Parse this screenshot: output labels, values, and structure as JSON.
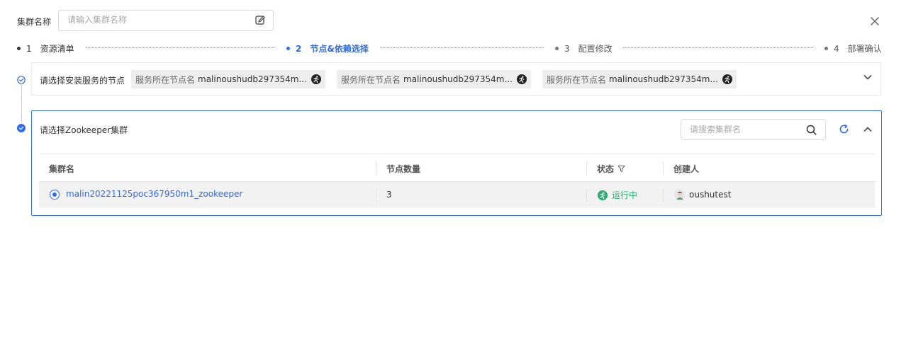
{
  "header": {
    "cluster_name_label": "集群名称",
    "cluster_name_placeholder": "请输入集群名称"
  },
  "steps": [
    {
      "num": "1",
      "label": "资源清单",
      "state": "done"
    },
    {
      "num": "2",
      "label": "节点&依赖选择",
      "state": "active"
    },
    {
      "num": "3",
      "label": "配置修改",
      "state": "todo"
    },
    {
      "num": "4",
      "label": "部署确认",
      "state": "todo"
    }
  ],
  "node_section": {
    "title": "请选择安装服务的节点",
    "tags": [
      {
        "key": "服务所在节点名",
        "value": "malinoushudb297354m..."
      },
      {
        "key": "服务所在节点名",
        "value": "malinoushudb297354m..."
      },
      {
        "key": "服务所在节点名",
        "value": "malinoushudb297354m..."
      }
    ]
  },
  "zk_section": {
    "title": "请选择Zookeeper集群",
    "search_placeholder": "请搜索集群名",
    "columns": [
      "集群名",
      "节点数量",
      "状态",
      "创建人"
    ],
    "rows": [
      {
        "name": "malin20221125poc367950m1_zookeeper",
        "nodes": "3",
        "status": "运行中",
        "creator": "oushutest",
        "selected": true
      }
    ]
  },
  "colors": {
    "accent": "#2f6bed",
    "running": "#2bab6f",
    "tag_bg": "#eeeeee",
    "row_bg": "#f2f2f2"
  },
  "icons": [
    "edit-icon",
    "close-icon",
    "check-circle-icon",
    "running-icon",
    "chevron-down-icon",
    "chevron-up-icon",
    "search-icon",
    "refresh-icon",
    "filter-icon",
    "avatar"
  ]
}
